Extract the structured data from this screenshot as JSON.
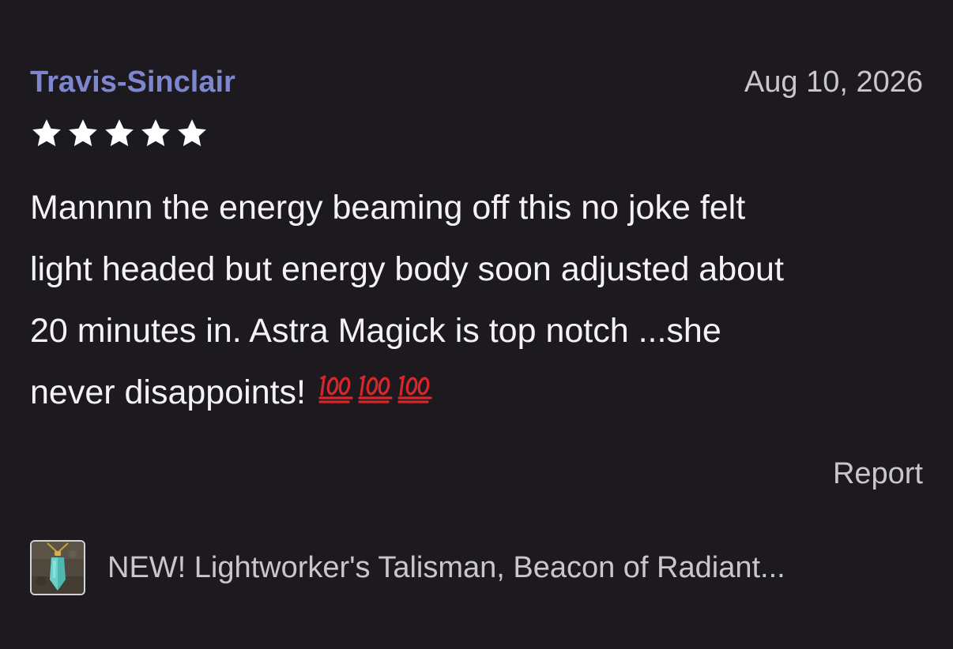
{
  "review": {
    "reviewer": "Travis-Sinclair",
    "date": "Aug 10, 2026",
    "rating": 5,
    "rating_max": 5,
    "body_lines": [
      "Mannnn the energy beaming off this no joke felt",
      "light headed but energy body soon adjusted about",
      "20 minutes in. Astra Magick is top notch ...she",
      "never disappoints!"
    ],
    "emoji": [
      "hundred-points-icon",
      "hundred-points-icon",
      "hundred-points-icon"
    ],
    "report_label": "Report"
  },
  "product": {
    "title": "NEW! Lightworker's Talisman, Beacon of Radiant...",
    "thumbnail_icon": "crystal-pendant-icon"
  },
  "colors": {
    "background": "#1c1a1f",
    "reviewer_name": "#7d86cf",
    "text_primary": "#f4f2f6",
    "text_secondary": "#c9c6cc",
    "star": "#ffffff",
    "emoji_red": "#d9262b"
  }
}
